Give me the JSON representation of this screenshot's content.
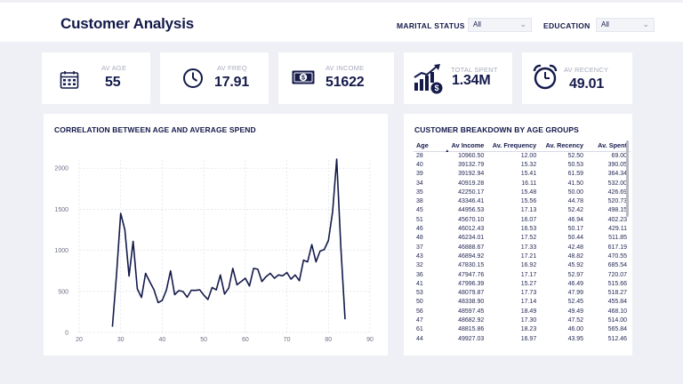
{
  "header": {
    "title": "Customer Analysis",
    "marital_label": "MARITAL STATUS",
    "marital_value": "All",
    "education_label": "EDUCATION",
    "education_value": "All"
  },
  "kpis": [
    {
      "label": "AV AGE",
      "value": "55",
      "icon": "calendar-icon"
    },
    {
      "label": "AV FREQ",
      "value": "17.91",
      "icon": "clock-icon"
    },
    {
      "label": "AV INCOME",
      "value": "51622",
      "icon": "money-icon"
    },
    {
      "label": "TOTAL SPENT",
      "value": "1.34M",
      "icon": "growth-chart-icon"
    },
    {
      "label": "AV RECENCY",
      "value": "49.01",
      "icon": "alarm-clock-icon"
    }
  ],
  "line_panel": {
    "title": "CORRELATION BETWEEN AGE AND AVERAGE SPEND"
  },
  "table_panel": {
    "title": "CUSTOMER BREAKDOWN BY AGE GROUPS",
    "columns": [
      "Age",
      "Av Income",
      "Av. Frequency",
      "Av. Recency",
      "Av. Spent"
    ],
    "sort_indicator": "▲",
    "rows": [
      [
        "28",
        "10960.50",
        "12.00",
        "52.50",
        "69.00"
      ],
      [
        "40",
        "39132.79",
        "15.32",
        "50.53",
        "390.05"
      ],
      [
        "39",
        "39192.94",
        "15.41",
        "61.59",
        "364.34"
      ],
      [
        "34",
        "40919.28",
        "16.11",
        "41.50",
        "532.00"
      ],
      [
        "35",
        "42250.17",
        "15.48",
        "50.00",
        "426.69"
      ],
      [
        "38",
        "43346.41",
        "15.56",
        "44.78",
        "520.73"
      ],
      [
        "45",
        "44956.53",
        "17.13",
        "52.42",
        "498.15"
      ],
      [
        "51",
        "45670.10",
        "16.07",
        "46.94",
        "402.23"
      ],
      [
        "46",
        "46012.43",
        "16.53",
        "50.17",
        "429.11"
      ],
      [
        "48",
        "46234.01",
        "17.52",
        "50.44",
        "511.85"
      ],
      [
        "37",
        "46888.67",
        "17.33",
        "42.48",
        "617.19"
      ],
      [
        "43",
        "46894.92",
        "17.21",
        "48.82",
        "470.55"
      ],
      [
        "32",
        "47830.15",
        "16.92",
        "45.92",
        "685.54"
      ],
      [
        "36",
        "47947.76",
        "17.17",
        "52.97",
        "720.07"
      ],
      [
        "41",
        "47996.39",
        "15.27",
        "46.49",
        "515.66"
      ],
      [
        "53",
        "48079.87",
        "17.73",
        "47.99",
        "518.27"
      ],
      [
        "50",
        "48338.90",
        "17.14",
        "52.45",
        "455.84"
      ],
      [
        "56",
        "48597.45",
        "18.49",
        "49.49",
        "468.10"
      ],
      [
        "47",
        "48682.92",
        "17.30",
        "47.52",
        "514.00"
      ],
      [
        "61",
        "48815.86",
        "18.23",
        "46.00",
        "565.84"
      ],
      [
        "44",
        "49927.03",
        "16.97",
        "43.95",
        "512.46"
      ]
    ]
  },
  "chart_data": {
    "type": "line",
    "title": "CORRELATION BETWEEN AGE AND AVERAGE SPEND",
    "xlabel": "",
    "ylabel": "",
    "xlim": [
      20,
      90
    ],
    "ylim": [
      0,
      2100
    ],
    "x_ticks": [
      "20",
      "30",
      "40",
      "50",
      "60",
      "70",
      "80",
      "90"
    ],
    "y_ticks": [
      "0",
      "500",
      "1000",
      "1500",
      "2000"
    ],
    "x_tick_values": [
      20,
      30,
      40,
      50,
      60,
      70,
      80,
      90
    ],
    "y_tick_values": [
      0,
      500,
      1000,
      1500,
      2000
    ],
    "grid": true,
    "line_color": "#141a4a",
    "series": [
      {
        "x": [
          28,
          29,
          30,
          31,
          32,
          33,
          34,
          35,
          36,
          37,
          38,
          39,
          40,
          41,
          42,
          43,
          44,
          45,
          46,
          47,
          48,
          49,
          50,
          51,
          52,
          53,
          54,
          55,
          56,
          57,
          58,
          59,
          60,
          61,
          62,
          63,
          64,
          65,
          66,
          67,
          68,
          69,
          70,
          71,
          72,
          73,
          74,
          75,
          76,
          77,
          78,
          79,
          80,
          81,
          82,
          83,
          84
        ],
        "y": [
          69,
          700,
          1450,
          1250,
          686,
          1110,
          532,
          427,
          720,
          617,
          521,
          364,
          390,
          516,
          750,
          460,
          510,
          498,
          429,
          514,
          512,
          520,
          456,
          402,
          548,
          518,
          700,
          468,
          540,
          780,
          580,
          620,
          660,
          566,
          780,
          770,
          620,
          680,
          720,
          660,
          700,
          690,
          730,
          650,
          700,
          630,
          880,
          860,
          1070,
          860,
          990,
          1010,
          1120,
          1470,
          2110,
          1030,
          160
        ]
      }
    ]
  }
}
